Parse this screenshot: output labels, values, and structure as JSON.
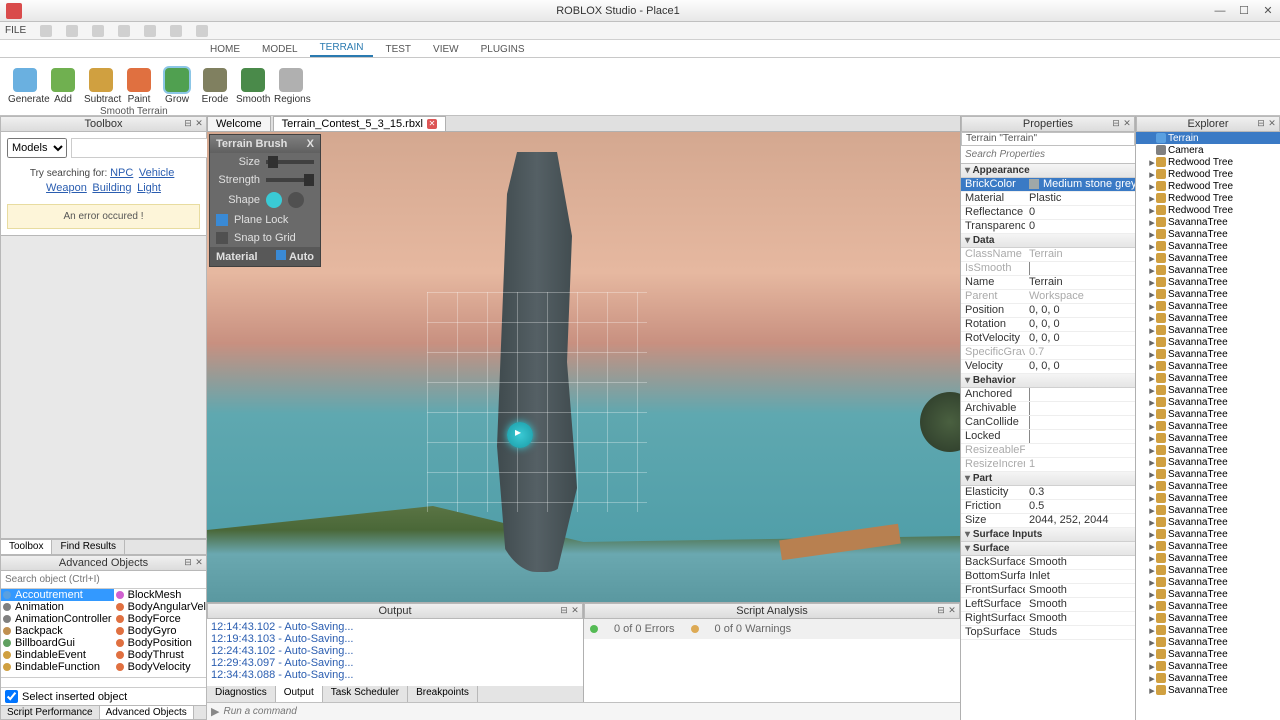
{
  "window": {
    "title": "ROBLOX Studio - Place1"
  },
  "menubar": {
    "file": "FILE"
  },
  "ribbon_tabs": [
    "HOME",
    "MODEL",
    "TERRAIN",
    "TEST",
    "VIEW",
    "PLUGINS"
  ],
  "ribbon_active": 2,
  "terrain_tools": [
    {
      "label": "Generate",
      "color": "#6ab0e0"
    },
    {
      "label": "Add",
      "color": "#70b050"
    },
    {
      "label": "Subtract",
      "color": "#d0a040"
    },
    {
      "label": "Paint",
      "color": "#e07040"
    },
    {
      "label": "Grow",
      "color": "#50a050",
      "active": true
    },
    {
      "label": "Erode",
      "color": "#808060"
    },
    {
      "label": "Smooth",
      "color": "#4a8a4a"
    },
    {
      "label": "Regions",
      "color": "#b0b0b0"
    }
  ],
  "smooth_terrain_label": "Smooth Terrain",
  "toolbox": {
    "title": "Toolbox",
    "dropdown": "Models",
    "hint_prefix": "Try searching for: ",
    "hints": [
      "NPC",
      "Vehicle",
      "Weapon",
      "Building",
      "Light"
    ],
    "error": "An error occured !"
  },
  "left_bottom_tabs": [
    "Toolbox",
    "Find Results"
  ],
  "adv_objects": {
    "title": "Advanced Objects",
    "search_placeholder": "Search object (Ctrl+I)",
    "col1": [
      {
        "n": "Accoutrement",
        "c": "#5aa0e0",
        "sel": true
      },
      {
        "n": "Animation",
        "c": "#808080"
      },
      {
        "n": "AnimationController",
        "c": "#808080"
      },
      {
        "n": "Backpack",
        "c": "#c09050"
      },
      {
        "n": "BillboardGui",
        "c": "#60a060"
      },
      {
        "n": "BindableEvent",
        "c": "#d0a040"
      },
      {
        "n": "BindableFunction",
        "c": "#d0a040"
      }
    ],
    "col2": [
      {
        "n": "BlockMesh",
        "c": "#d060d0"
      },
      {
        "n": "BodyAngularVelocity",
        "c": "#e07040"
      },
      {
        "n": "BodyForce",
        "c": "#e07040"
      },
      {
        "n": "BodyGyro",
        "c": "#e07040"
      },
      {
        "n": "BodyPosition",
        "c": "#e07040"
      },
      {
        "n": "BodyThrust",
        "c": "#e07040"
      },
      {
        "n": "BodyVelocity",
        "c": "#e07040"
      }
    ],
    "select_inserted": "Select inserted object",
    "bottom_tabs": [
      "Script Performance",
      "Advanced Objects"
    ]
  },
  "doc_tabs": [
    {
      "label": "Welcome"
    },
    {
      "label": "Terrain_Contest_5_3_15.rbxl",
      "active": true,
      "closable": true
    }
  ],
  "terrain_brush": {
    "title": "Terrain Brush",
    "size": "Size",
    "strength": "Strength",
    "shape": "Shape",
    "plane_lock": "Plane Lock",
    "snap": "Snap to Grid",
    "material": "Material",
    "auto": "Auto"
  },
  "output": {
    "title": "Output",
    "lines": [
      "12:14:43.102 - Auto-Saving...",
      "12:19:43.103 - Auto-Saving...",
      "12:24:43.102 - Auto-Saving...",
      "12:29:43.097 - Auto-Saving...",
      "12:34:43.088 - Auto-Saving..."
    ],
    "tabs": [
      "Diagnostics",
      "Output",
      "Task Scheduler",
      "Breakpoints"
    ]
  },
  "script_analysis": {
    "title": "Script Analysis",
    "errors": "0 of 0 Errors",
    "warnings": "0 of 0 Warnings"
  },
  "cmd_placeholder": "Run a command",
  "properties": {
    "title": "Properties",
    "selection": "Terrain \"Terrain\"",
    "search_placeholder": "Search Properties",
    "cats": [
      {
        "name": "Appearance",
        "rows": [
          {
            "k": "BrickColor",
            "v": "Medium stone grey",
            "sel": true,
            "swatch": "#a0a8a8"
          },
          {
            "k": "Material",
            "v": "Plastic"
          },
          {
            "k": "Reflectance",
            "v": "0"
          },
          {
            "k": "Transparency",
            "v": "0"
          }
        ]
      },
      {
        "name": "Data",
        "rows": [
          {
            "k": "ClassName",
            "v": "Terrain",
            "dim": true
          },
          {
            "k": "IsSmooth",
            "v": "",
            "dim": true,
            "check": true,
            "checked": true
          },
          {
            "k": "Name",
            "v": "Terrain"
          },
          {
            "k": "Parent",
            "v": "Workspace",
            "dim": true
          },
          {
            "k": "Position",
            "v": "0, 0, 0"
          },
          {
            "k": "Rotation",
            "v": "0, 0, 0"
          },
          {
            "k": "RotVelocity",
            "v": "0, 0, 0"
          },
          {
            "k": "SpecificGravity",
            "v": "0.7",
            "dim": true
          },
          {
            "k": "Velocity",
            "v": "0, 0, 0"
          }
        ]
      },
      {
        "name": "Behavior",
        "rows": [
          {
            "k": "Anchored",
            "check": true,
            "checked": true
          },
          {
            "k": "Archivable",
            "check": true,
            "checked": true
          },
          {
            "k": "CanCollide",
            "check": true,
            "checked": true
          },
          {
            "k": "Locked",
            "check": true,
            "checked": true
          },
          {
            "k": "ResizeableFaces",
            "v": "",
            "dim": true
          },
          {
            "k": "ResizeIncrement",
            "v": "1",
            "dim": true
          }
        ]
      },
      {
        "name": "Part",
        "rows": [
          {
            "k": "Elasticity",
            "v": "0.3"
          },
          {
            "k": "Friction",
            "v": "0.5"
          },
          {
            "k": "Size",
            "v": "2044, 252, 2044"
          }
        ]
      },
      {
        "name": "Surface Inputs",
        "rows": []
      },
      {
        "name": "Surface",
        "rows": [
          {
            "k": "BackSurface",
            "v": "Smooth"
          },
          {
            "k": "BottomSurface",
            "v": "Inlet"
          },
          {
            "k": "FrontSurface",
            "v": "Smooth"
          },
          {
            "k": "LeftSurface",
            "v": "Smooth"
          },
          {
            "k": "RightSurface",
            "v": "Smooth"
          },
          {
            "k": "TopSurface",
            "v": "Studs"
          }
        ]
      }
    ]
  },
  "explorer": {
    "title": "Explorer",
    "items": [
      {
        "n": "Terrain",
        "c": "#5aa0e0",
        "sel": true,
        "indent": 1
      },
      {
        "n": "Camera",
        "c": "#808080",
        "indent": 1
      },
      {
        "n": "Redwood Tree",
        "c": "#d0a040",
        "indent": 1,
        "exp": true
      },
      {
        "n": "Redwood Tree",
        "c": "#d0a040",
        "indent": 1,
        "exp": true
      },
      {
        "n": "Redwood Tree",
        "c": "#d0a040",
        "indent": 1,
        "exp": true
      },
      {
        "n": "Redwood Tree",
        "c": "#d0a040",
        "indent": 1,
        "exp": true
      },
      {
        "n": "Redwood Tree",
        "c": "#d0a040",
        "indent": 1,
        "exp": true
      },
      {
        "n": "SavannaTree",
        "c": "#d0a040",
        "indent": 1,
        "exp": true
      },
      {
        "n": "SavannaTree",
        "c": "#d0a040",
        "indent": 1,
        "exp": true
      },
      {
        "n": "SavannaTree",
        "c": "#d0a040",
        "indent": 1,
        "exp": true
      },
      {
        "n": "SavannaTree",
        "c": "#d0a040",
        "indent": 1,
        "exp": true
      },
      {
        "n": "SavannaTree",
        "c": "#d0a040",
        "indent": 1,
        "exp": true
      },
      {
        "n": "SavannaTree",
        "c": "#d0a040",
        "indent": 1,
        "exp": true
      },
      {
        "n": "SavannaTree",
        "c": "#d0a040",
        "indent": 1,
        "exp": true
      },
      {
        "n": "SavannaTree",
        "c": "#d0a040",
        "indent": 1,
        "exp": true
      },
      {
        "n": "SavannaTree",
        "c": "#d0a040",
        "indent": 1,
        "exp": true
      },
      {
        "n": "SavannaTree",
        "c": "#d0a040",
        "indent": 1,
        "exp": true
      },
      {
        "n": "SavannaTree",
        "c": "#d0a040",
        "indent": 1,
        "exp": true
      },
      {
        "n": "SavannaTree",
        "c": "#d0a040",
        "indent": 1,
        "exp": true
      },
      {
        "n": "SavannaTree",
        "c": "#d0a040",
        "indent": 1,
        "exp": true
      },
      {
        "n": "SavannaTree",
        "c": "#d0a040",
        "indent": 1,
        "exp": true
      },
      {
        "n": "SavannaTree",
        "c": "#d0a040",
        "indent": 1,
        "exp": true
      },
      {
        "n": "SavannaTree",
        "c": "#d0a040",
        "indent": 1,
        "exp": true
      },
      {
        "n": "SavannaTree",
        "c": "#d0a040",
        "indent": 1,
        "exp": true
      },
      {
        "n": "SavannaTree",
        "c": "#d0a040",
        "indent": 1,
        "exp": true
      },
      {
        "n": "SavannaTree",
        "c": "#d0a040",
        "indent": 1,
        "exp": true
      },
      {
        "n": "SavannaTree",
        "c": "#d0a040",
        "indent": 1,
        "exp": true
      },
      {
        "n": "SavannaTree",
        "c": "#d0a040",
        "indent": 1,
        "exp": true
      },
      {
        "n": "SavannaTree",
        "c": "#d0a040",
        "indent": 1,
        "exp": true
      },
      {
        "n": "SavannaTree",
        "c": "#d0a040",
        "indent": 1,
        "exp": true
      },
      {
        "n": "SavannaTree",
        "c": "#d0a040",
        "indent": 1,
        "exp": true
      },
      {
        "n": "SavannaTree",
        "c": "#d0a040",
        "indent": 1,
        "exp": true
      },
      {
        "n": "SavannaTree",
        "c": "#d0a040",
        "indent": 1,
        "exp": true
      },
      {
        "n": "SavannaTree",
        "c": "#d0a040",
        "indent": 1,
        "exp": true
      },
      {
        "n": "SavannaTree",
        "c": "#d0a040",
        "indent": 1,
        "exp": true
      },
      {
        "n": "SavannaTree",
        "c": "#d0a040",
        "indent": 1,
        "exp": true
      },
      {
        "n": "SavannaTree",
        "c": "#d0a040",
        "indent": 1,
        "exp": true
      },
      {
        "n": "SavannaTree",
        "c": "#d0a040",
        "indent": 1,
        "exp": true
      },
      {
        "n": "SavannaTree",
        "c": "#d0a040",
        "indent": 1,
        "exp": true
      },
      {
        "n": "SavannaTree",
        "c": "#d0a040",
        "indent": 1,
        "exp": true
      },
      {
        "n": "SavannaTree",
        "c": "#d0a040",
        "indent": 1,
        "exp": true
      },
      {
        "n": "SavannaTree",
        "c": "#d0a040",
        "indent": 1,
        "exp": true
      },
      {
        "n": "SavannaTree",
        "c": "#d0a040",
        "indent": 1,
        "exp": true
      },
      {
        "n": "SavannaTree",
        "c": "#d0a040",
        "indent": 1,
        "exp": true
      },
      {
        "n": "SavannaTree",
        "c": "#d0a040",
        "indent": 1,
        "exp": true
      },
      {
        "n": "SavannaTree",
        "c": "#d0a040",
        "indent": 1,
        "exp": true
      },
      {
        "n": "SavannaTree",
        "c": "#d0a040",
        "indent": 1,
        "exp": true
      }
    ]
  }
}
